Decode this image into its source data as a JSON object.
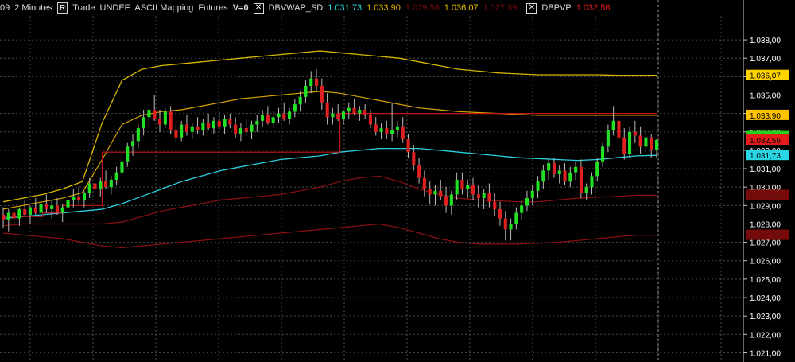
{
  "header": {
    "symbol_tail": "09",
    "interval": "2 Minutes",
    "r_button": "R",
    "trade": "Trade",
    "undef": "UNDEF",
    "mapping": "ASCII Mapping",
    "futures": "Futures",
    "volume": "V=0",
    "ind1_name": "DBVWAP_SD",
    "ind1_values": [
      {
        "text": "1.031,73",
        "color": "#28d7df"
      },
      {
        "text": "1.033,90",
        "color": "#e6b400"
      },
      {
        "text": "1.029,56",
        "color": "#7a0a0a"
      },
      {
        "text": "1.036,07",
        "color": "#e6c400"
      },
      {
        "text": "1.027,39",
        "color": "#7a0a0a"
      }
    ],
    "ind2_name": "DBPVP",
    "ind2_value": {
      "text": "1.032,56",
      "color": "#e51c1c"
    }
  },
  "chart_data": {
    "type": "candlestick",
    "ylim": [
      1020.5,
      1039.3
    ],
    "y_ticks": [
      "1.021,00",
      "1.022,00",
      "1.023,00",
      "1.024,00",
      "1.025,00",
      "1.026,00",
      "1.027,00",
      "1.028,00",
      "1.029,00",
      "1.030,00",
      "1.031,00",
      "1.032,00",
      "1.033,00",
      "1.034,00",
      "1.035,00",
      "1.036,00",
      "1.037,00",
      "1.038,00"
    ],
    "price_labels": [
      {
        "text": "1.036,07",
        "value": 1036.07,
        "bg": "#ffd400",
        "fg": "#000000"
      },
      {
        "text": "1.033,90",
        "value": 1033.9,
        "bg": "#ffc400",
        "fg": "#000000"
      },
      {
        "text": "1.032,75",
        "value": 1032.75,
        "bg": "#1fd61f",
        "fg": "#000000"
      },
      {
        "text": "1.032,56",
        "value": 1032.56,
        "bg": "#e51c1c",
        "fg": "#000000"
      },
      {
        "text": "1.031,73",
        "value": 1031.73,
        "bg": "#29d6e6",
        "fg": "#000000"
      },
      {
        "text": "1.029,56",
        "value": 1029.56,
        "bg": "#7a0a0a",
        "fg": "#5a1010"
      },
      {
        "text": "1.027,39",
        "value": 1027.39,
        "bg": "#7a0a0a",
        "fg": "#5a1010"
      }
    ],
    "candles": [
      [
        1028.5,
        1028.9,
        1027.8,
        1028.2
      ],
      [
        1028.2,
        1028.8,
        1027.6,
        1028.6
      ],
      [
        1028.6,
        1029.0,
        1028.0,
        1028.3
      ],
      [
        1028.3,
        1028.9,
        1027.9,
        1028.8
      ],
      [
        1028.8,
        1029.3,
        1028.4,
        1028.5
      ],
      [
        1028.5,
        1029.0,
        1028.0,
        1028.9
      ],
      [
        1028.9,
        1029.4,
        1028.5,
        1028.6
      ],
      [
        1028.6,
        1029.2,
        1028.2,
        1029.1
      ],
      [
        1029.1,
        1029.6,
        1028.6,
        1028.8
      ],
      [
        1028.8,
        1029.3,
        1028.3,
        1029.0
      ],
      [
        1029.0,
        1029.4,
        1028.5,
        1028.6
      ],
      [
        1028.6,
        1029.1,
        1028.1,
        1028.9
      ],
      [
        1028.9,
        1029.5,
        1028.6,
        1029.3
      ],
      [
        1029.3,
        1029.9,
        1028.9,
        1029.5
      ],
      [
        1029.5,
        1030.0,
        1029.1,
        1029.3
      ],
      [
        1029.3,
        1029.8,
        1028.9,
        1029.7
      ],
      [
        1029.7,
        1030.5,
        1029.4,
        1030.2
      ],
      [
        1030.2,
        1030.8,
        1029.8,
        1029.9
      ],
      [
        1029.9,
        1030.5,
        1029.5,
        1030.3
      ],
      [
        1030.3,
        1030.9,
        1029.9,
        1030.0
      ],
      [
        1030.0,
        1030.6,
        1029.6,
        1030.4
      ],
      [
        1030.4,
        1031.1,
        1030.1,
        1030.8
      ],
      [
        1030.8,
        1031.6,
        1030.5,
        1031.4
      ],
      [
        1031.4,
        1032.4,
        1031.1,
        1032.2
      ],
      [
        1032.2,
        1032.9,
        1031.7,
        1032.5
      ],
      [
        1032.5,
        1033.4,
        1032.1,
        1033.2
      ],
      [
        1033.2,
        1034.2,
        1032.8,
        1033.8
      ],
      [
        1033.8,
        1034.6,
        1033.3,
        1034.2
      ],
      [
        1034.2,
        1035.0,
        1033.6,
        1033.7
      ],
      [
        1033.7,
        1034.2,
        1033.0,
        1033.4
      ],
      [
        1033.4,
        1034.3,
        1033.2,
        1034.1
      ],
      [
        1034.1,
        1034.4,
        1032.9,
        1033.1
      ],
      [
        1033.1,
        1033.5,
        1032.4,
        1032.7
      ],
      [
        1032.7,
        1033.6,
        1032.5,
        1033.4
      ],
      [
        1033.4,
        1033.9,
        1032.8,
        1033.0
      ],
      [
        1033.0,
        1033.5,
        1032.6,
        1033.3
      ],
      [
        1033.3,
        1033.8,
        1032.9,
        1033.1
      ],
      [
        1033.1,
        1033.7,
        1032.8,
        1033.5
      ],
      [
        1033.5,
        1034.0,
        1033.1,
        1033.2
      ],
      [
        1033.2,
        1033.8,
        1032.9,
        1033.6
      ],
      [
        1033.6,
        1034.1,
        1033.1,
        1033.3
      ],
      [
        1033.3,
        1033.9,
        1032.9,
        1033.7
      ],
      [
        1033.7,
        1034.0,
        1033.2,
        1033.4
      ],
      [
        1033.4,
        1033.8,
        1032.7,
        1032.9
      ],
      [
        1032.9,
        1033.5,
        1032.5,
        1033.2
      ],
      [
        1033.2,
        1033.7,
        1032.8,
        1033.0
      ],
      [
        1033.0,
        1033.6,
        1032.6,
        1033.4
      ],
      [
        1033.4,
        1033.9,
        1033.0,
        1033.6
      ],
      [
        1033.6,
        1034.2,
        1033.3,
        1033.9
      ],
      [
        1033.9,
        1034.4,
        1033.4,
        1033.5
      ],
      [
        1033.5,
        1034.1,
        1033.2,
        1033.8
      ],
      [
        1033.8,
        1034.3,
        1033.5,
        1034.0
      ],
      [
        1034.0,
        1034.6,
        1033.6,
        1033.7
      ],
      [
        1033.7,
        1034.3,
        1033.4,
        1034.1
      ],
      [
        1034.1,
        1034.8,
        1033.8,
        1034.5
      ],
      [
        1034.5,
        1035.2,
        1034.1,
        1034.9
      ],
      [
        1034.9,
        1035.8,
        1034.6,
        1035.5
      ],
      [
        1035.5,
        1036.3,
        1035.1,
        1035.9
      ],
      [
        1035.9,
        1036.4,
        1035.2,
        1035.5
      ],
      [
        1035.5,
        1035.9,
        1034.2,
        1034.6
      ],
      [
        1034.6,
        1035.1,
        1033.4,
        1033.8
      ],
      [
        1033.8,
        1034.3,
        1033.4,
        1034.0
      ],
      [
        1034.0,
        1034.5,
        1033.6,
        1033.7
      ],
      [
        1033.7,
        1034.2,
        1033.4,
        1034.1
      ],
      [
        1034.1,
        1034.6,
        1033.7,
        1034.3
      ],
      [
        1034.3,
        1034.8,
        1033.9,
        1034.0
      ],
      [
        1034.0,
        1034.4,
        1033.6,
        1034.2
      ],
      [
        1034.2,
        1034.5,
        1033.7,
        1033.9
      ],
      [
        1033.9,
        1034.2,
        1033.2,
        1033.4
      ],
      [
        1033.4,
        1033.8,
        1032.8,
        1033.0
      ],
      [
        1033.0,
        1033.5,
        1032.6,
        1033.2
      ],
      [
        1033.2,
        1033.6,
        1032.6,
        1032.9
      ],
      [
        1032.9,
        1034.6,
        1032.5,
        1033.1
      ],
      [
        1033.1,
        1033.6,
        1032.7,
        1033.3
      ],
      [
        1033.3,
        1033.8,
        1032.4,
        1032.6
      ],
      [
        1032.6,
        1032.9,
        1031.6,
        1031.9
      ],
      [
        1031.9,
        1032.3,
        1030.9,
        1031.2
      ],
      [
        1031.2,
        1031.6,
        1030.2,
        1030.5
      ],
      [
        1030.5,
        1030.9,
        1029.5,
        1029.9
      ],
      [
        1029.9,
        1030.3,
        1029.1,
        1029.6
      ],
      [
        1029.6,
        1030.1,
        1029.0,
        1029.8
      ],
      [
        1029.8,
        1030.4,
        1029.3,
        1029.5
      ],
      [
        1029.5,
        1030.0,
        1028.6,
        1029.0
      ],
      [
        1029.0,
        1029.8,
        1028.5,
        1029.6
      ],
      [
        1029.6,
        1030.8,
        1029.3,
        1030.4
      ],
      [
        1030.4,
        1030.8,
        1029.6,
        1029.9
      ],
      [
        1029.9,
        1030.4,
        1029.4,
        1030.1
      ],
      [
        1030.1,
        1030.5,
        1029.3,
        1029.6
      ],
      [
        1029.6,
        1030.1,
        1028.9,
        1029.4
      ],
      [
        1029.4,
        1029.9,
        1028.8,
        1029.7
      ],
      [
        1029.7,
        1030.2,
        1028.9,
        1029.2
      ],
      [
        1029.2,
        1029.7,
        1028.4,
        1028.8
      ],
      [
        1028.8,
        1029.2,
        1027.9,
        1028.3
      ],
      [
        1028.3,
        1028.7,
        1027.1,
        1027.7
      ],
      [
        1027.7,
        1028.3,
        1027.1,
        1028.0
      ],
      [
        1028.0,
        1028.9,
        1027.7,
        1028.6
      ],
      [
        1028.6,
        1029.3,
        1028.2,
        1029.0
      ],
      [
        1029.0,
        1029.8,
        1028.7,
        1029.4
      ],
      [
        1029.4,
        1030.1,
        1029.0,
        1029.8
      ],
      [
        1029.8,
        1030.6,
        1029.4,
        1030.3
      ],
      [
        1030.3,
        1031.2,
        1029.9,
        1030.9
      ],
      [
        1030.9,
        1031.6,
        1030.4,
        1031.3
      ],
      [
        1031.3,
        1031.6,
        1030.5,
        1030.7
      ],
      [
        1030.7,
        1031.2,
        1030.2,
        1030.9
      ],
      [
        1030.9,
        1031.3,
        1030.1,
        1030.3
      ],
      [
        1030.3,
        1031.1,
        1030.0,
        1030.8
      ],
      [
        1030.8,
        1031.4,
        1030.4,
        1031.1
      ],
      [
        1031.1,
        1031.5,
        1029.4,
        1029.7
      ],
      [
        1029.7,
        1030.2,
        1029.3,
        1030.0
      ],
      [
        1030.0,
        1030.8,
        1029.6,
        1030.6
      ],
      [
        1030.6,
        1031.6,
        1030.3,
        1031.4
      ],
      [
        1031.4,
        1032.4,
        1031.1,
        1032.2
      ],
      [
        1032.2,
        1033.4,
        1031.9,
        1033.1
      ],
      [
        1033.1,
        1034.4,
        1032.8,
        1033.6
      ],
      [
        1033.6,
        1034.0,
        1032.5,
        1032.7
      ],
      [
        1032.7,
        1033.2,
        1031.5,
        1031.8
      ],
      [
        1031.8,
        1033.3,
        1031.6,
        1033.0
      ],
      [
        1033.0,
        1033.6,
        1032.4,
        1032.8
      ],
      [
        1032.8,
        1033.3,
        1031.8,
        1032.2
      ],
      [
        1032.2,
        1033.1,
        1031.9,
        1032.7
      ],
      [
        1032.7,
        1032.9,
        1031.6,
        1032.0
      ],
      [
        1032.0,
        1032.6,
        1031.6,
        1032.56
      ]
    ],
    "vwap": [
      1028.3,
      1028.4,
      1028.5,
      1028.6,
      1028.7,
      1028.8,
      1029.1,
      1029.5,
      1029.9,
      1030.3,
      1030.6,
      1030.9,
      1031.1,
      1031.3,
      1031.5,
      1031.6,
      1031.7,
      1031.9,
      1032.0,
      1032.1,
      1032.1,
      1032.1,
      1032.0,
      1031.9,
      1031.8,
      1031.7,
      1031.6,
      1031.55,
      1031.5,
      1031.45,
      1031.5,
      1031.6,
      1031.7,
      1031.73
    ],
    "sd1_up": [
      1028.8,
      1029.0,
      1029.2,
      1029.4,
      1029.7,
      1031.5,
      1033.4,
      1033.9,
      1034.1,
      1034.2,
      1034.4,
      1034.6,
      1034.8,
      1034.9,
      1035.0,
      1035.1,
      1035.2,
      1035.1,
      1034.9,
      1034.7,
      1034.5,
      1034.3,
      1034.2,
      1034.1,
      1034.05,
      1034.0,
      1033.95,
      1033.9,
      1033.9,
      1033.9,
      1033.9,
      1033.9,
      1033.9,
      1033.9
    ],
    "sd2_up": [
      1029.2,
      1029.4,
      1029.6,
      1029.9,
      1030.3,
      1033.5,
      1035.8,
      1036.4,
      1036.6,
      1036.7,
      1036.8,
      1036.9,
      1037.0,
      1037.1,
      1037.2,
      1037.3,
      1037.4,
      1037.3,
      1037.2,
      1037.1,
      1037.0,
      1036.8,
      1036.6,
      1036.4,
      1036.3,
      1036.2,
      1036.15,
      1036.1,
      1036.1,
      1036.1,
      1036.1,
      1036.07,
      1036.07,
      1036.07
    ],
    "sd1_dn": [
      1027.9,
      1028.0,
      1028.0,
      1028.0,
      1028.0,
      1028.0,
      1028.1,
      1028.4,
      1028.7,
      1028.9,
      1029.1,
      1029.3,
      1029.4,
      1029.5,
      1029.6,
      1029.8,
      1030.0,
      1030.3,
      1030.5,
      1030.6,
      1030.3,
      1029.9,
      1029.6,
      1029.4,
      1029.3,
      1029.25,
      1029.2,
      1029.2,
      1029.3,
      1029.4,
      1029.45,
      1029.5,
      1029.56,
      1029.56
    ],
    "sd2_dn": [
      1027.5,
      1027.4,
      1027.3,
      1027.2,
      1027.0,
      1026.8,
      1026.7,
      1026.8,
      1026.9,
      1027.0,
      1027.1,
      1027.2,
      1027.3,
      1027.4,
      1027.5,
      1027.6,
      1027.7,
      1027.8,
      1027.9,
      1028.0,
      1027.8,
      1027.5,
      1027.2,
      1027.0,
      1026.9,
      1026.9,
      1026.9,
      1026.95,
      1027.0,
      1027.1,
      1027.2,
      1027.3,
      1027.39,
      1027.39
    ],
    "poc": [
      1028.4,
      1028.4,
      1028.6,
      1029.0,
      1029.0,
      1031.9,
      1031.9,
      1031.9,
      1031.9,
      1031.9,
      1031.9,
      1031.9,
      1031.9,
      1031.9,
      1031.9,
      1031.9,
      1031.9,
      1034.0,
      1034.0,
      1034.0,
      1034.0,
      1034.0,
      1034.0,
      1034.0,
      1034.0,
      1034.0,
      1034.0,
      1034.0,
      1034.0,
      1034.0,
      1034.0,
      1034.0,
      1034.0,
      1034.0
    ]
  },
  "colors": {
    "up": "#22e022",
    "down": "#e02020",
    "wick": "#bcbcbc",
    "grid": "#4a4a4a",
    "vwap": "#2ad0e0",
    "sd1": "#d8a400",
    "sd2": "#d8b800",
    "sdlow": "#8c1010",
    "poc": "#c01818",
    "axis_text": "#ffffff",
    "axis_line": "#c8c8c8"
  }
}
